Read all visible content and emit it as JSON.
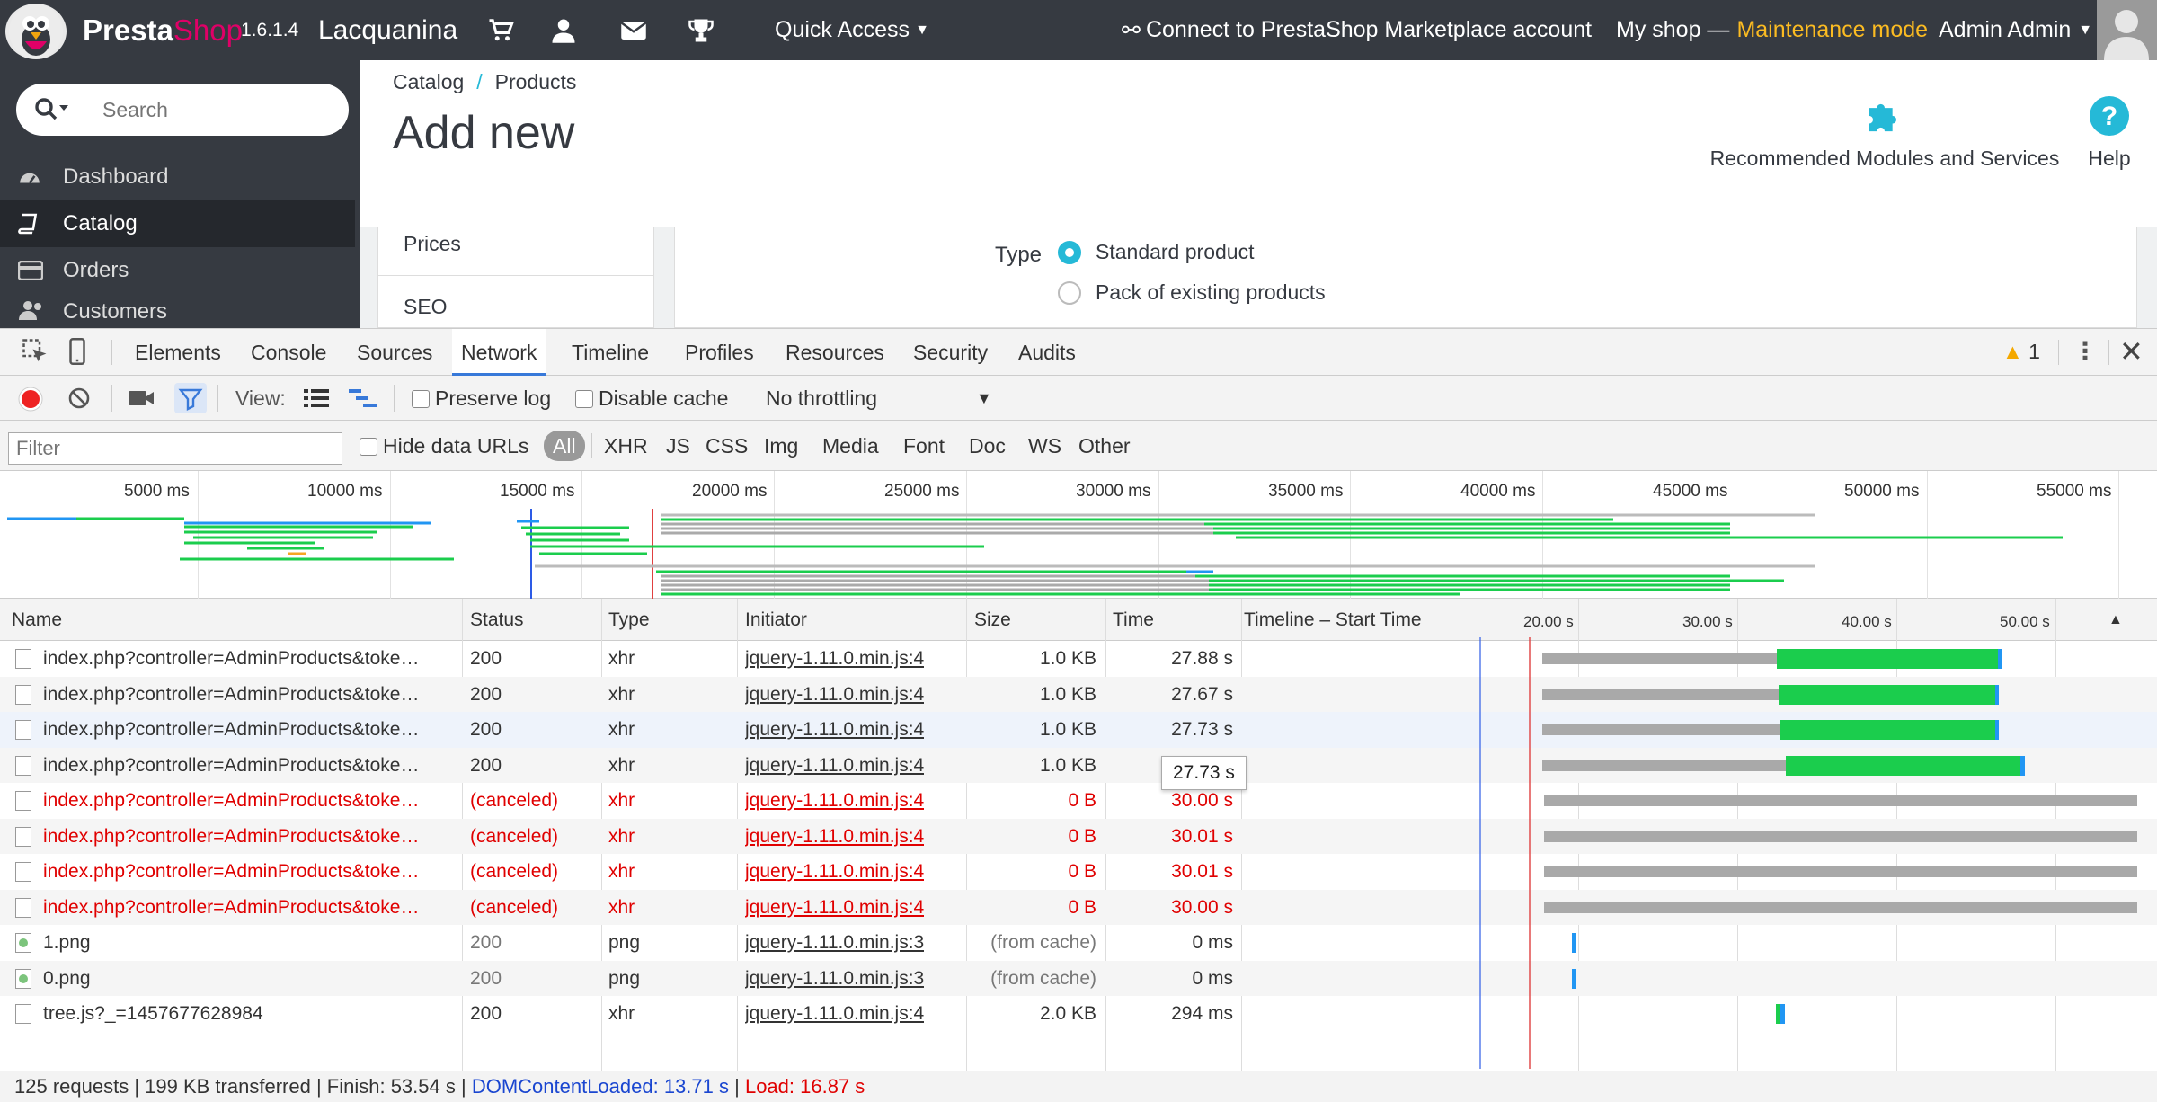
{
  "topbar": {
    "brand_a": "Presta",
    "brand_b": "Shop",
    "version": "1.6.1.4",
    "shop_name": "Lacquanina",
    "quick_access": "Quick Access",
    "connect": "Connect to PrestaShop Marketplace account",
    "my_shop": "My shop —",
    "maintenance": "Maintenance mode",
    "admin": "Admin Admin"
  },
  "sidebar": {
    "search_placeholder": "Search",
    "items": [
      {
        "label": "Dashboard",
        "icon": "dashboard-icon"
      },
      {
        "label": "Catalog",
        "icon": "book-icon",
        "active": true
      },
      {
        "label": "Orders",
        "icon": "credit-card-icon"
      },
      {
        "label": "Customers",
        "icon": "users-icon"
      }
    ]
  },
  "header": {
    "breadcrumb": [
      "Catalog",
      "Products"
    ],
    "title": "Add new",
    "modules_label": "Recommended Modules and Services",
    "help_label": "Help"
  },
  "product_tabs": [
    "Prices",
    "SEO"
  ],
  "form": {
    "type_label": "Type",
    "options": [
      "Standard product",
      "Pack of existing products"
    ],
    "selected": 0
  },
  "devtools": {
    "tabs": [
      "Elements",
      "Console",
      "Sources",
      "Network",
      "Timeline",
      "Profiles",
      "Resources",
      "Security",
      "Audits"
    ],
    "selected_tab": "Network",
    "warning_count": "1",
    "toolbar": {
      "view_label": "View:",
      "preserve_log": "Preserve log",
      "disable_cache": "Disable cache",
      "throttling": "No throttling"
    },
    "filter": {
      "placeholder": "Filter",
      "hide_data_urls": "Hide data URLs",
      "types": [
        "All",
        "XHR",
        "JS",
        "CSS",
        "Img",
        "Media",
        "Font",
        "Doc",
        "WS",
        "Other"
      ]
    },
    "overview_ticks": [
      "5000 ms",
      "10000 ms",
      "15000 ms",
      "20000 ms",
      "25000 ms",
      "30000 ms",
      "35000 ms",
      "40000 ms",
      "45000 ms",
      "50000 ms",
      "55000 ms"
    ],
    "columns": [
      "Name",
      "Status",
      "Type",
      "Initiator",
      "Size",
      "Time",
      "Timeline – Start Time"
    ],
    "timeline_ticks": [
      "20.00 s",
      "30.00 s",
      "40.00 s",
      "50.00 s"
    ],
    "rows": [
      {
        "name": "index.php?controller=AdminProducts&toke…",
        "status": "200",
        "type": "xhr",
        "initiator": "jquery-1.11.0.min.js:4",
        "size": "1.0 KB",
        "time": "27.88 s"
      },
      {
        "name": "index.php?controller=AdminProducts&toke…",
        "status": "200",
        "type": "xhr",
        "initiator": "jquery-1.11.0.min.js:4",
        "size": "1.0 KB",
        "time": "27.67 s"
      },
      {
        "name": "index.php?controller=AdminProducts&toke…",
        "status": "200",
        "type": "xhr",
        "initiator": "jquery-1.11.0.min.js:4",
        "size": "1.0 KB",
        "time": "27.73 s"
      },
      {
        "name": "index.php?controller=AdminProducts&toke…",
        "status": "200",
        "type": "xhr",
        "initiator": "jquery-1.11.0.min.js:4",
        "size": "1.0 KB",
        "time": ""
      },
      {
        "name": "index.php?controller=AdminProducts&toke…",
        "status": "(canceled)",
        "type": "xhr",
        "initiator": "jquery-1.11.0.min.js:4",
        "size": "0 B",
        "time": "30.00 s"
      },
      {
        "name": "index.php?controller=AdminProducts&toke…",
        "status": "(canceled)",
        "type": "xhr",
        "initiator": "jquery-1.11.0.min.js:4",
        "size": "0 B",
        "time": "30.01 s"
      },
      {
        "name": "index.php?controller=AdminProducts&toke…",
        "status": "(canceled)",
        "type": "xhr",
        "initiator": "jquery-1.11.0.min.js:4",
        "size": "0 B",
        "time": "30.01 s"
      },
      {
        "name": "index.php?controller=AdminProducts&toke…",
        "status": "(canceled)",
        "type": "xhr",
        "initiator": "jquery-1.11.0.min.js:4",
        "size": "0 B",
        "time": "30.00 s"
      },
      {
        "name": "1.png",
        "status": "200",
        "type": "png",
        "initiator": "jquery-1.11.0.min.js:3",
        "size": "(from cache)",
        "time": "0 ms"
      },
      {
        "name": "0.png",
        "status": "200",
        "type": "png",
        "initiator": "jquery-1.11.0.min.js:3",
        "size": "(from cache)",
        "time": "0 ms"
      },
      {
        "name": "tree.js?_=1457677628984",
        "status": "200",
        "type": "xhr",
        "initiator": "jquery-1.11.0.min.js:4",
        "size": "2.0 KB",
        "time": "294 ms"
      }
    ],
    "tooltip": "27.73 s",
    "status": {
      "requests": "125 requests",
      "transferred": "199 KB transferred",
      "finish": "Finish: 53.54 s",
      "dcl": "DOMContentLoaded: 13.71 s",
      "load": "Load: 16.87 s"
    }
  },
  "colors": {
    "topbar": "#363a41",
    "brand_accent": "#df0067",
    "maintenance": "#fbbb22",
    "link": "#25b9d7",
    "bar_wait": "#a9a9a9",
    "bar_download": "#1bcd4d",
    "bar_recv": "#2196f3",
    "error": "#e00000"
  }
}
